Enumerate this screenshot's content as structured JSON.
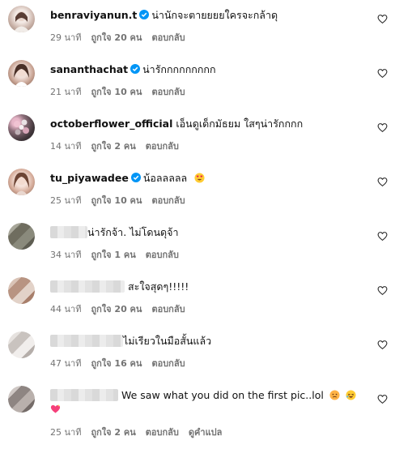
{
  "comments": [
    {
      "username": "benraviyanun.t",
      "verified": true,
      "text": "น่านักจะตายยยยใครจะกล้าดุ",
      "time": "29 นาที",
      "likes": "ถูกใจ 20 คน",
      "reply": "ตอบกลับ"
    },
    {
      "username": "sananthachat",
      "verified": true,
      "text": "น่ารักกกกกกกกก",
      "time": "21 นาที",
      "likes": "ถูกใจ 10 คน",
      "reply": "ตอบกลับ"
    },
    {
      "username": "octoberflower_official",
      "verified": false,
      "text": "เอ็นดูเด็กมัธยม ใสๆน่ารักกกก",
      "time": "14 นาที",
      "likes": "ถูกใจ 2 คน",
      "reply": "ตอบกลับ"
    },
    {
      "username": "tu_piyawadee",
      "verified": true,
      "text": "น้อลลลลล",
      "time": "25 นาที",
      "likes": "ถูกใจ 10 คน",
      "reply": "ตอบกลับ"
    },
    {
      "username": "",
      "verified": false,
      "text": "น่ารักจ้า. ไม่โดนดุจ้า",
      "time": "34 นาที",
      "likes": "ถูกใจ 1 คน",
      "reply": "ตอบกลับ"
    },
    {
      "username": "",
      "verified": false,
      "text": "สะใจสุดๆ!!!!!",
      "time": "44 นาที",
      "likes": "ถูกใจ 20 คน",
      "reply": "ตอบกลับ"
    },
    {
      "username": "",
      "verified": false,
      "text": "ไม่เรียวในมือสั้นแล้ว",
      "time": "47 นาที",
      "likes": "ถูกใจ 16 คน",
      "reply": "ตอบกลับ"
    },
    {
      "username": "",
      "verified": false,
      "text": "We saw what you did on the first pic..lol",
      "time": "25 นาที",
      "likes": "ถูกใจ 2 คน",
      "reply": "ตอบกลับ",
      "translate": "ดูคำแปล"
    }
  ],
  "icons": {
    "verified": "verified-badge-icon",
    "like": "heart-outline-icon"
  },
  "colors": {
    "verified_blue": "#0095f6",
    "meta_gray": "#737373",
    "text": "#111111"
  }
}
